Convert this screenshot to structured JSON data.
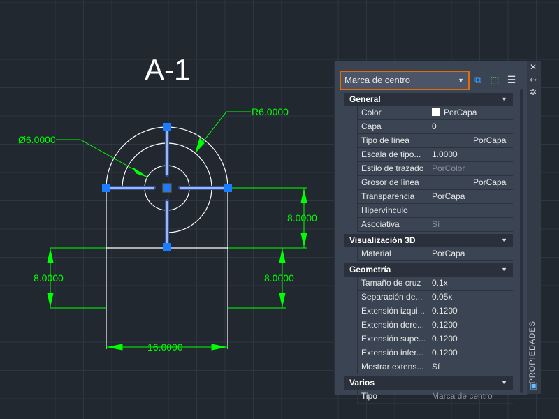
{
  "drawing": {
    "title": "A-1",
    "dims": {
      "diameter": "Ø6.0000",
      "radius": "R6.0000",
      "right_height": "8.0000",
      "left_height": "8.0000",
      "right_lower": "8.0000",
      "width": "16.0000"
    }
  },
  "colors": {
    "dimension": "#00ff00",
    "grip": "#1a7cff",
    "highlight": "#e06c0c",
    "background": "#212830"
  },
  "panel": {
    "selector": "Marca de centro",
    "toolbar": [
      "quick-select-icon",
      "select-objects-icon",
      "toggle-pickadd-icon"
    ],
    "side_label": "PROPIEDADES",
    "sections": [
      {
        "title": "General",
        "rows": [
          {
            "k": "Color",
            "v": "PorCapa"
          },
          {
            "k": "Capa",
            "v": "0"
          },
          {
            "k": "Tipo de línea",
            "v": "PorCapa"
          },
          {
            "k": "Escala de tipo...",
            "v": "1.0000"
          },
          {
            "k": "Estilo de trazado",
            "v": "PorColor"
          },
          {
            "k": "Grosor de línea",
            "v": "PorCapa"
          },
          {
            "k": "Transparencia",
            "v": "PorCapa"
          },
          {
            "k": "Hipervínculo",
            "v": ""
          },
          {
            "k": "Asociativa",
            "v": "Sí"
          }
        ]
      },
      {
        "title": "Visualización 3D",
        "rows": [
          {
            "k": "Material",
            "v": "PorCapa"
          }
        ]
      },
      {
        "title": "Geometría",
        "rows": [
          {
            "k": "Tamaño de cruz",
            "v": "0.1x"
          },
          {
            "k": "Separación de...",
            "v": "0.05x"
          },
          {
            "k": "Extensión izqui...",
            "v": "0.1200"
          },
          {
            "k": "Extensión dere...",
            "v": "0.1200"
          },
          {
            "k": "Extensión supe...",
            "v": "0.1200"
          },
          {
            "k": "Extensión infer...",
            "v": "0.1200"
          },
          {
            "k": "Mostrar extens...",
            "v": "Sí"
          }
        ]
      },
      {
        "title": "Varios",
        "rows": [
          {
            "k": "Tipo",
            "v": "Marca de centro"
          }
        ]
      }
    ]
  }
}
